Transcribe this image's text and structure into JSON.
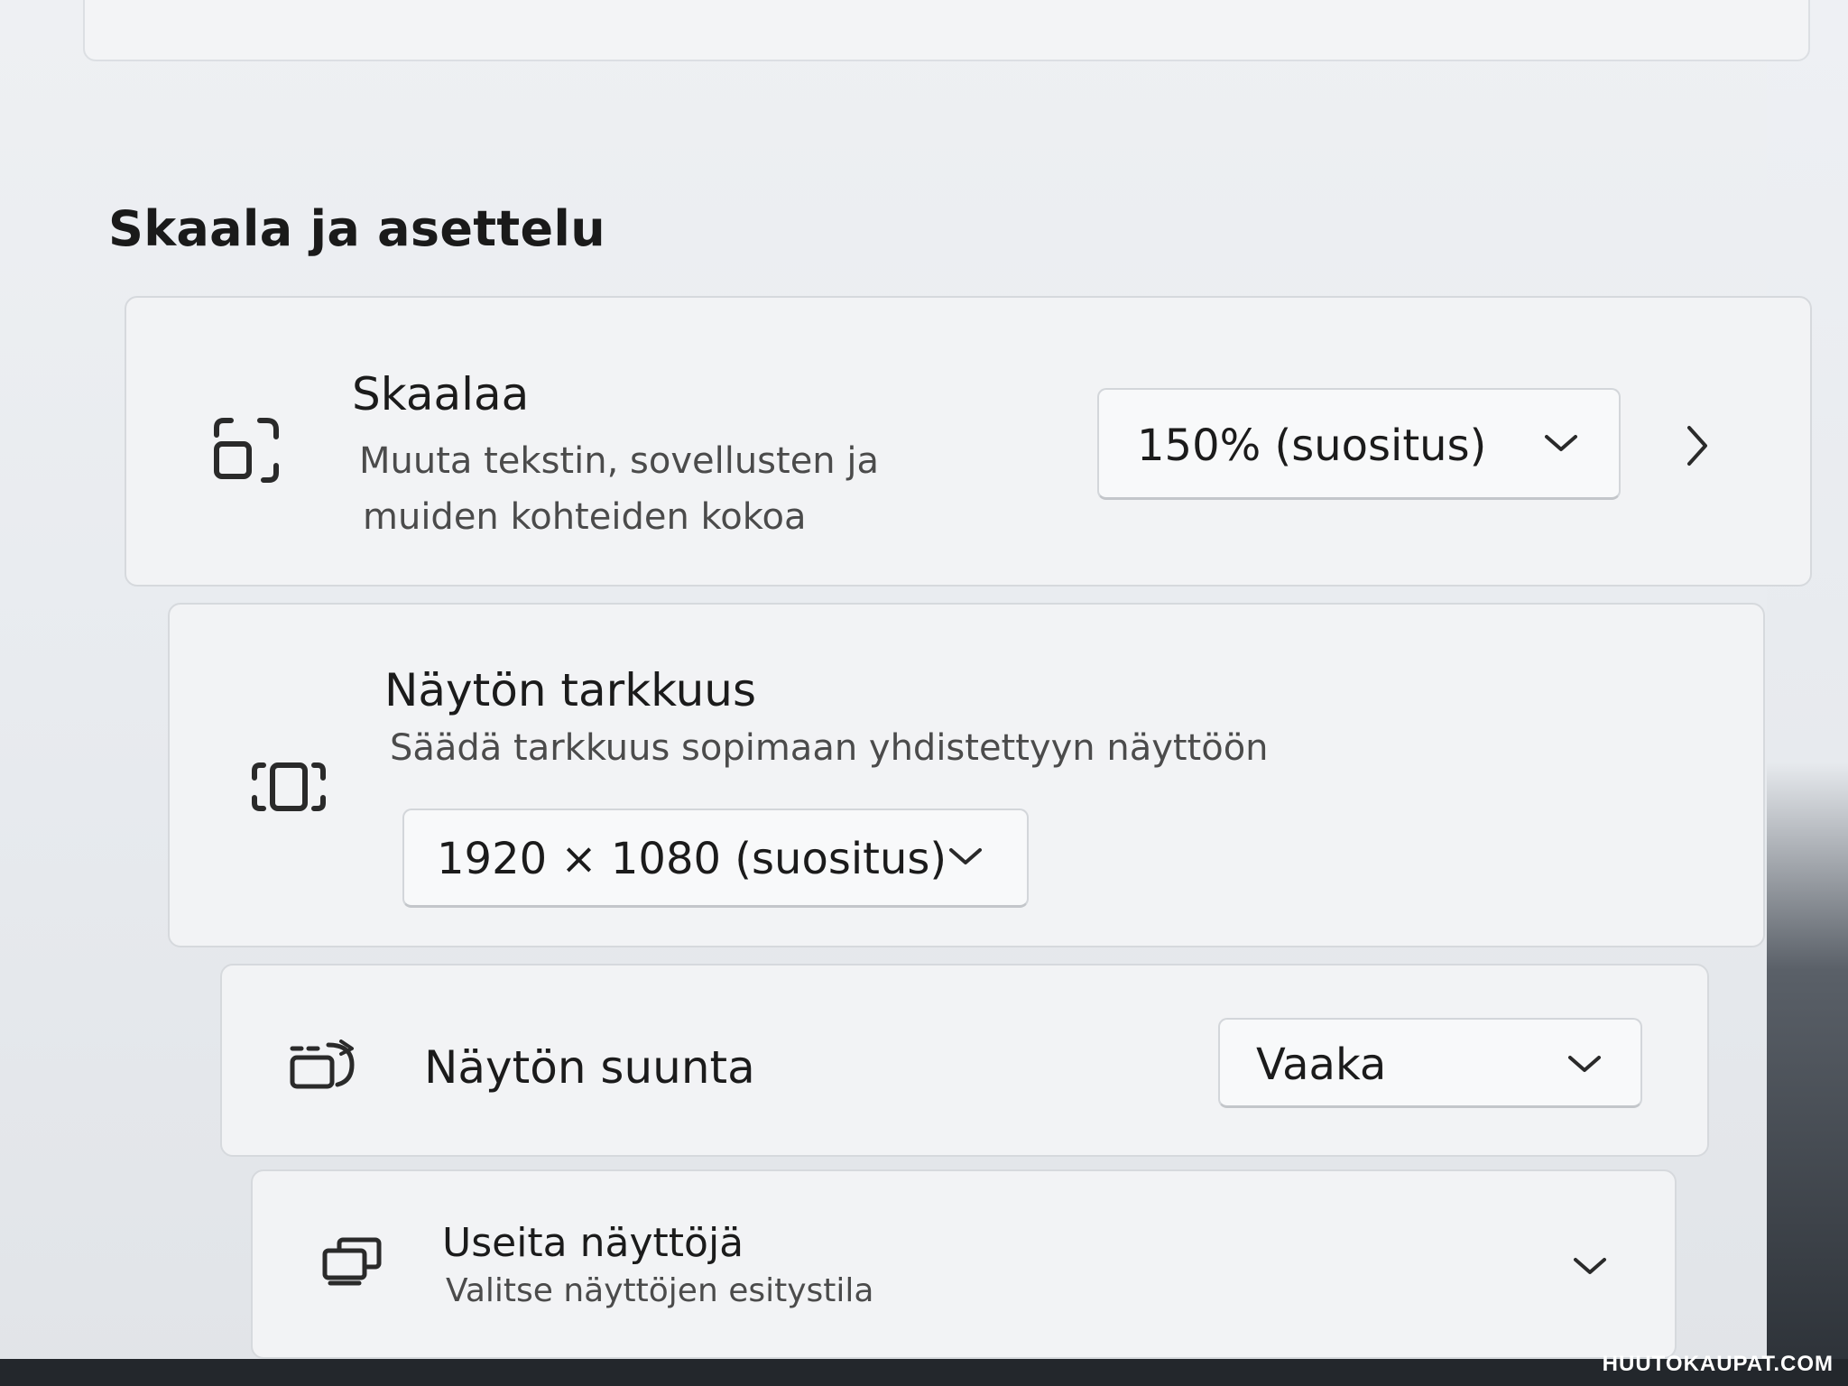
{
  "section": {
    "title": "Skaala ja asettelu"
  },
  "scale": {
    "title": "Skaalaa",
    "description_line1": "Muuta tekstin, sovellusten ja",
    "description_line2": "muiden kohteiden kokoa",
    "selected": "150% (suositus)",
    "icon": "scale-icon"
  },
  "resolution": {
    "title": "Näytön tarkkuus",
    "description": "Säädä tarkkuus sopimaan yhdistettyyn näyttöön",
    "selected": "1920 × 1080 (suositus)",
    "icon": "resolution-icon"
  },
  "orientation": {
    "title": "Näytön suunta",
    "selected": "Vaaka",
    "icon": "orientation-icon"
  },
  "multiple_displays": {
    "title": "Useita näyttöjä",
    "description": "Valitse näyttöjen esitystila",
    "icon": "multiple-displays-icon"
  },
  "watermark": {
    "text": "HUUTOKAUPAT.COM"
  }
}
